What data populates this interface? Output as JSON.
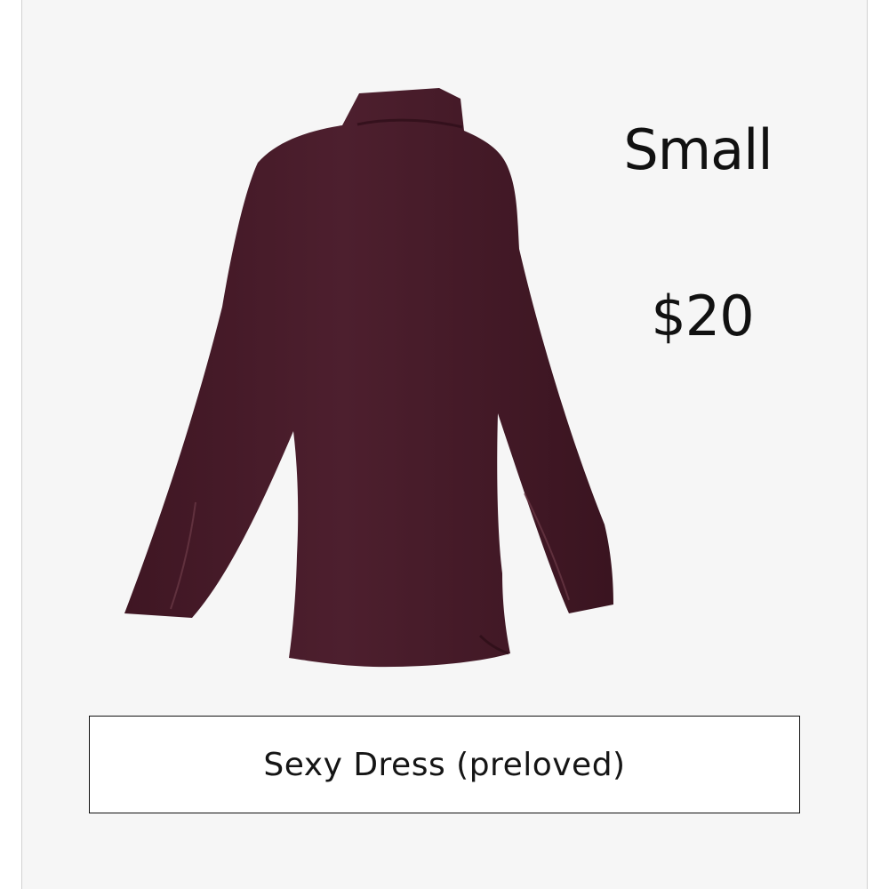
{
  "listing": {
    "size": "Small",
    "price": "$20",
    "title": "Sexy Dress (preloved)",
    "product_image": "long-sleeve-turtleneck-mini-dress",
    "garment_color": "#4a1e2c",
    "background_color": "#f6f6f6"
  }
}
